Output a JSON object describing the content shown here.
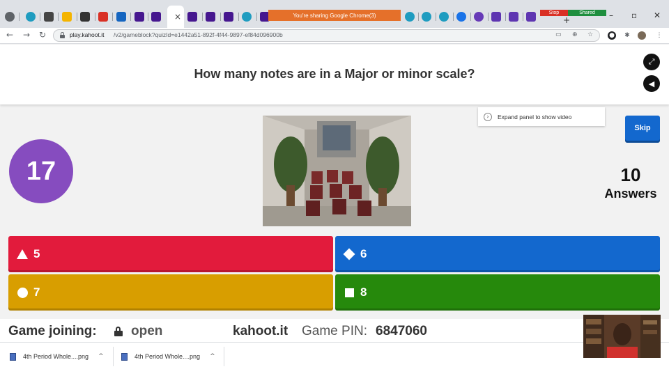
{
  "browser": {
    "sharing_banner": "You're sharing Google Chrome(3)",
    "stop_label": "Stop",
    "shared_label": "Shared",
    "url_host": "play.kahoot.it",
    "url_path": "/v2/gameblock?quizId=e1442a51-892f-4f44-9897-ef84d096900b",
    "tabs": [
      "chrome-icon",
      "circle-app-icon",
      "grid-app-icon",
      "folder-icon",
      "instagram-icon",
      "red-app-icon",
      "p-app-icon",
      "kahoot-icon",
      "kahoot-icon",
      "kahoot-icon",
      "kahoot-icon",
      "kahoot-icon",
      "circle-app-icon",
      "kahoot-icon",
      "circle-app-icon",
      "circle-app-icon",
      "circle-app-icon",
      "blue-app-icon",
      "purple-app-icon",
      "shield-icon",
      "shield-icon",
      "shield-icon"
    ]
  },
  "game": {
    "question": "How many notes are in a Major or minor scale?",
    "timer": "17",
    "expand_panel": "Expand panel to show video",
    "skip_label": "Skip",
    "answers_count": "10",
    "answers_label": "Answers",
    "answers": [
      {
        "shape": "triangle",
        "text": "5",
        "color": "#e21b3c"
      },
      {
        "shape": "diamond",
        "text": "6",
        "color": "#1368ce"
      },
      {
        "shape": "circle",
        "text": "7",
        "color": "#d89e00"
      },
      {
        "shape": "square",
        "text": "8",
        "color": "#26890c"
      }
    ]
  },
  "footer": {
    "join_label": "Game joining:",
    "join_status": "open",
    "site": "kahoot.it",
    "pin_label": "Game PIN:",
    "pin": "6847060"
  },
  "downloads": [
    {
      "name": "4th Period Whole....png"
    },
    {
      "name": "4th Period Whole....png"
    }
  ],
  "colors": {
    "timer": "#864cbf",
    "skip": "#1368ce"
  }
}
